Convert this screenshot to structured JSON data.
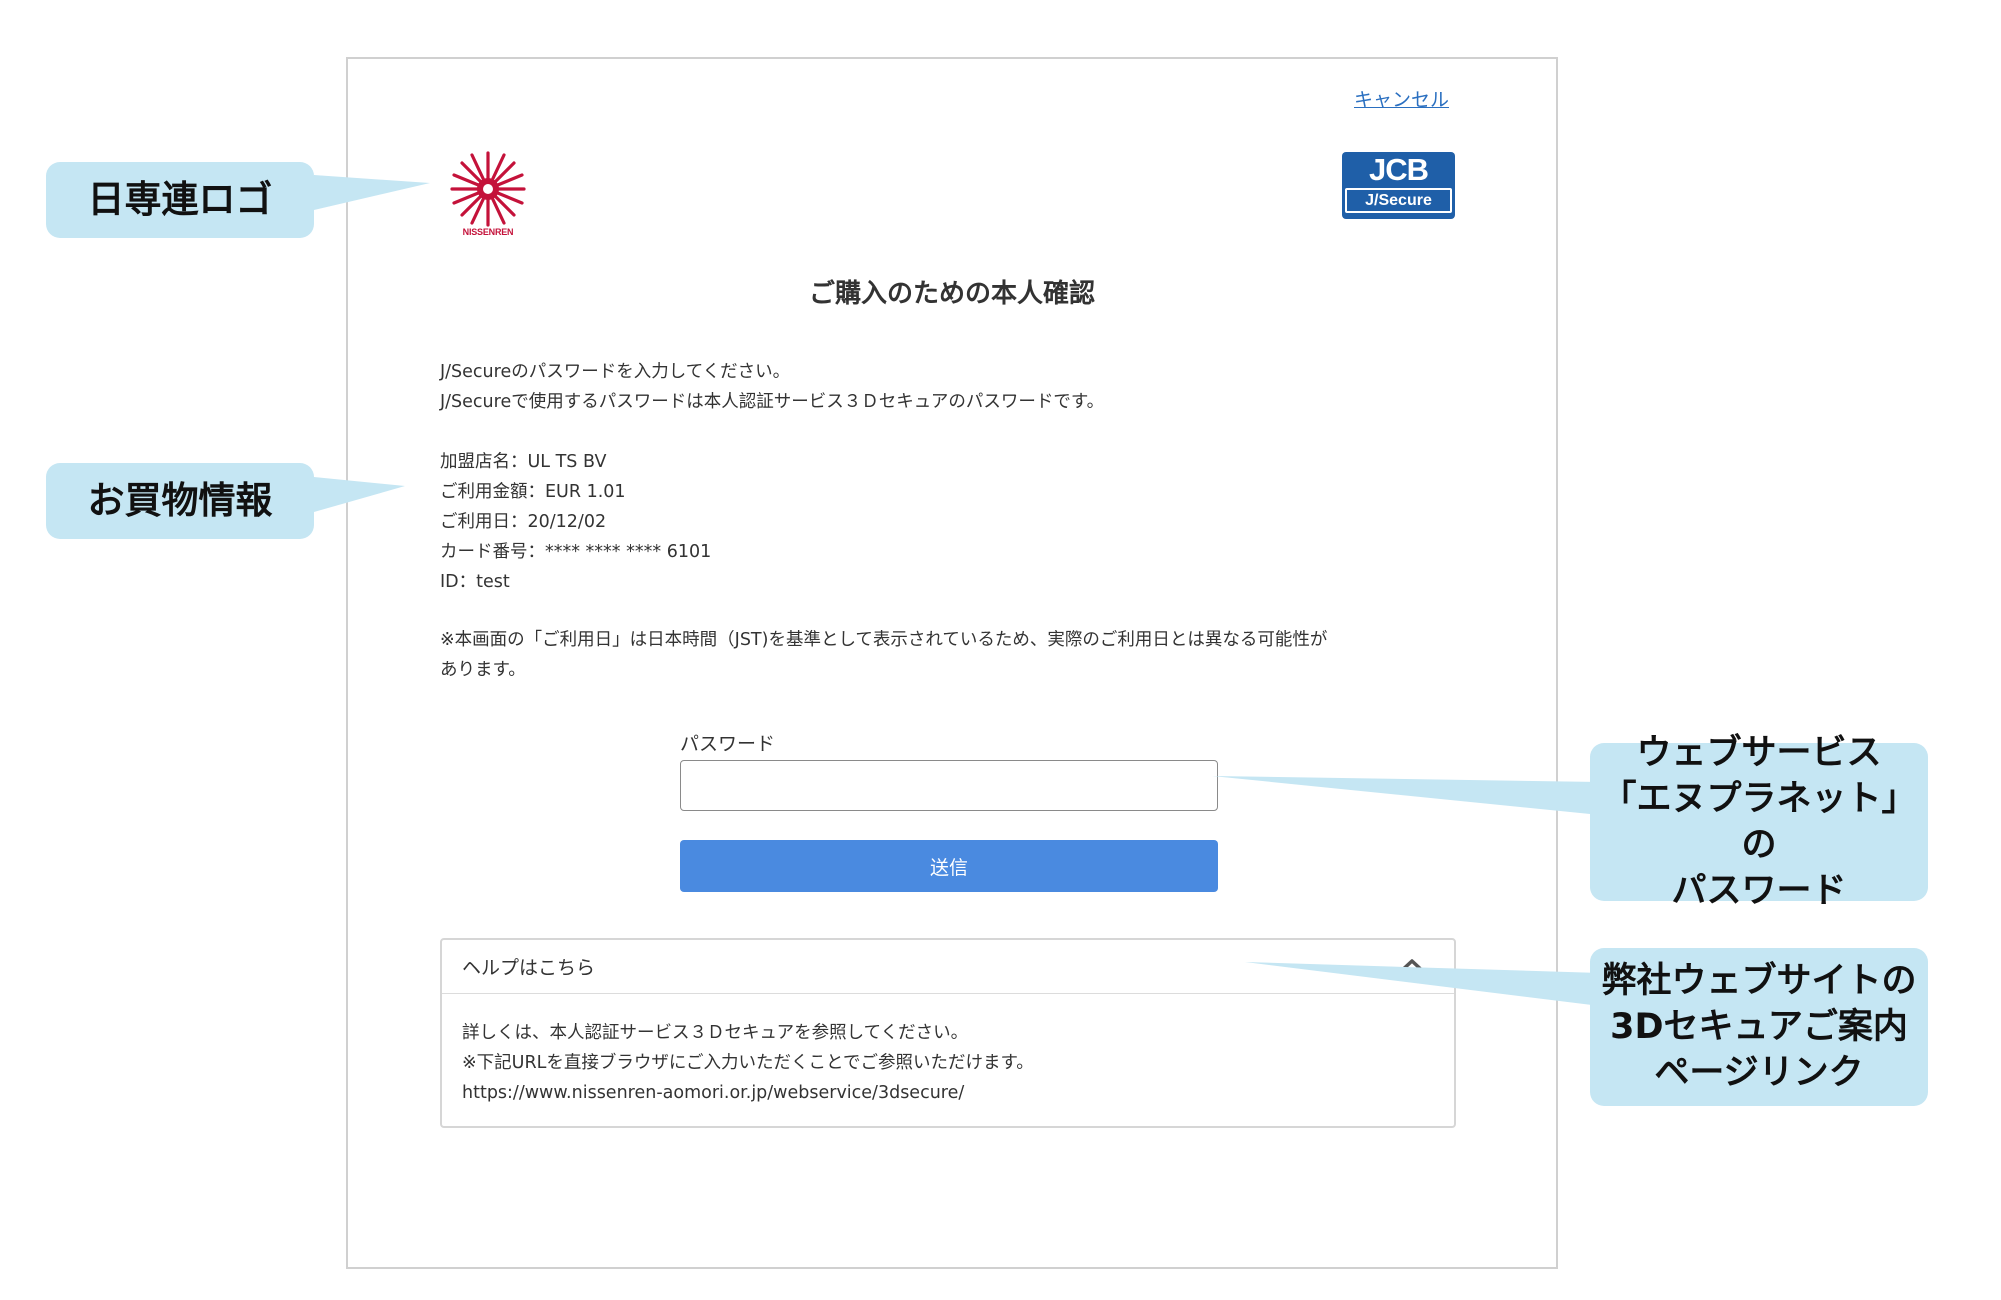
{
  "screen": {
    "cancel_link": "キャンセル",
    "logo_left_text": "NISSENREN",
    "jcb_logo": {
      "top": "JCB",
      "bottom": "J/Secure"
    },
    "heading": "ご購入のための本人確認",
    "instructions": [
      "J/Secureのパスワードを入力してください。",
      "J/Secureで使用するパスワードは本人認証サービス３Ｄセキュアのパスワードです。"
    ],
    "purchase_info": [
      "加盟店名：UL TS BV",
      "ご利用金額：EUR 1.01",
      "ご利用日：20/12/02",
      "カード番号：**** **** **** 6101",
      "ID：test"
    ],
    "note": [
      "※本画面の「ご利用日」は日本時間（JST)を基準として表示されているため、実際のご利用日とは異なる可能性が",
      "あります。"
    ],
    "password_label": "パスワード",
    "submit_label": "送信",
    "help": {
      "title": "ヘルプはこちら",
      "lines": [
        "詳しくは、本人認証サービス３Ｄセキュアを参照してください。",
        "※下記URLを直接ブラウザにご入力いただくことでご参照いただけます。",
        "https://www.nissenren-aomori.or.jp/webservice/3dsecure/"
      ]
    }
  },
  "annotations": {
    "logo": "日専連ロゴ",
    "purchase_info": "お買物情報",
    "password": [
      "ウェブサービス",
      "「エヌプラネット」の",
      "パスワード"
    ],
    "help_link": [
      "弊社ウェブサイトの",
      "3Dセキュアご案内",
      "ページリンク"
    ]
  },
  "colors": {
    "callout_bg": "#c5e6f3",
    "submit_bg": "#4a8ae0",
    "link": "#2a6fc0",
    "jcb_blue": "#1f5fa8",
    "logo_red": "#c4123a"
  },
  "icons": [
    "nissenren-logo-icon",
    "chevron-up-icon"
  ]
}
